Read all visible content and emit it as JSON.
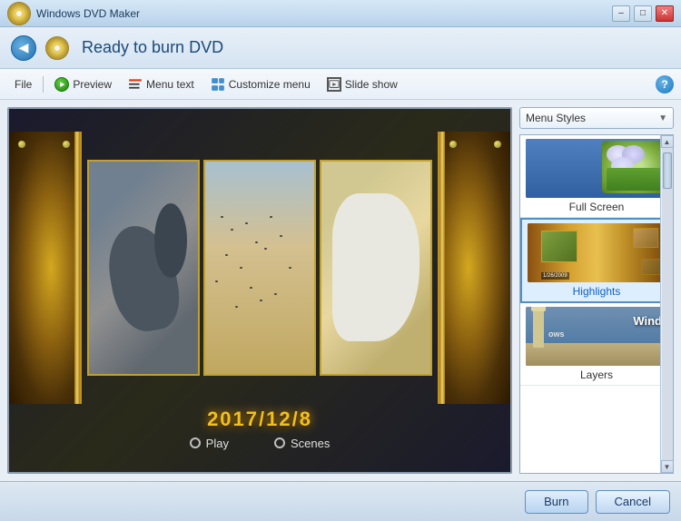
{
  "titlebar": {
    "title": "Windows DVD Maker",
    "min_label": "–",
    "max_label": "□",
    "close_label": "✕"
  },
  "header": {
    "title": "Ready to burn DVD"
  },
  "toolbar": {
    "file_label": "File",
    "preview_label": "Preview",
    "menu_text_label": "Menu text",
    "customize_menu_label": "Customize menu",
    "slide_show_label": "Slide show"
  },
  "preview": {
    "date_text": "2017/12/8",
    "play_label": "Play",
    "scenes_label": "Scenes"
  },
  "styles_panel": {
    "dropdown_label": "Menu Styles",
    "items": [
      {
        "label": "Full Screen",
        "selected": false
      },
      {
        "label": "Highlights",
        "selected": true
      },
      {
        "label": "Layers",
        "selected": false
      }
    ]
  },
  "bottom": {
    "burn_label": "Burn",
    "cancel_label": "Cancel"
  }
}
